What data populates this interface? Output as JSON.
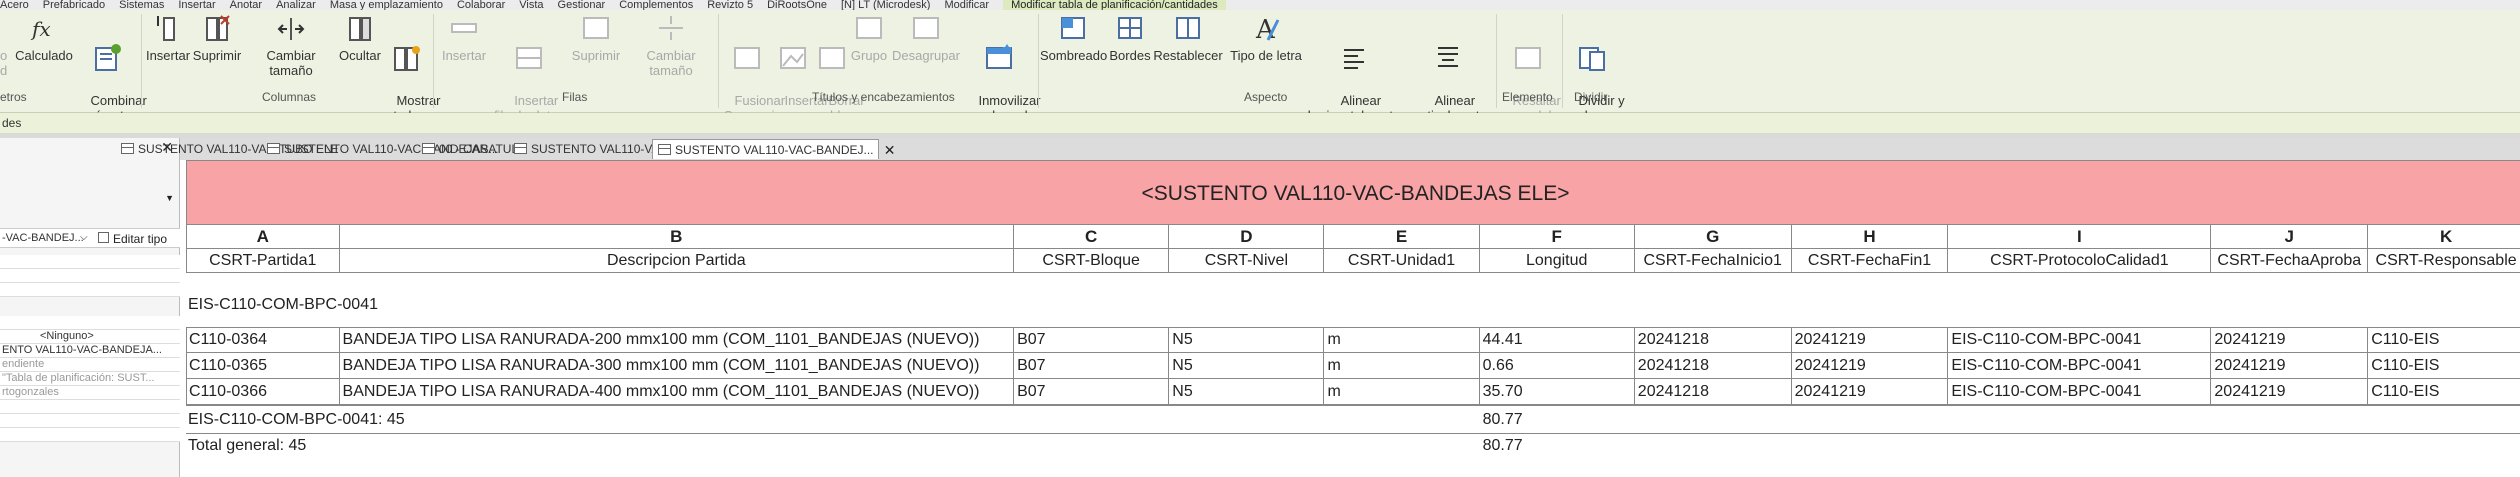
{
  "ribbon_tabs": [
    "Acero",
    "Prefabricado",
    "Sistemas",
    "Insertar",
    "Anotar",
    "Analizar",
    "Masa y emplazamiento",
    "Colaborar",
    "Vista",
    "Gestionar",
    "Complementos",
    "Revizto 5",
    "DiRootsOne",
    "[N] LT (Microdesk)",
    "Modificar",
    "Modificar tabla de planificación/cantidades"
  ],
  "ribbon_tools": {
    "parametros_partial": "o\nd",
    "calculado": "Calculado",
    "combinar": "Combinar\nparámetros",
    "insertar": "Insertar",
    "suprimir": "Suprimir",
    "cambiar_tamano": "Cambiar tamaño",
    "ocultar": "Ocultar",
    "mostrar_todo": "Mostrar\ntodo",
    "filas_insertar": "Insertar",
    "insertar_fila": "Insertar\nfila de datos",
    "filas_suprimir": "Suprimir",
    "filas_cambiar": "Cambiar tamaño",
    "fusionar": "Fusionar\nSeparar",
    "insertar_imagen": "Insertar\nimagen",
    "borrar_celda": "Borrar\ncelda",
    "grupo": "Grupo",
    "desagrupar": "Desagrupar",
    "inmovilizar": "Inmovilizar\nencabezado",
    "sombreado": "Sombreado",
    "bordes": "Bordes",
    "restablecer": "Restablecer",
    "tipo_letra": "Tipo de letra",
    "alinear_h": "Alinear\nhorizontalmente",
    "alinear_v": "Alinear\nverticalmente",
    "resaltar": "Resaltar\nen modelo",
    "dividir": "Dividir y\ncolocar"
  },
  "ribbon_groups": {
    "parametros": "etros",
    "columnas": "Columnas",
    "filas": "Filas",
    "titulos": "Títulos y encabezamientos",
    "aspecto": "Aspecto",
    "elemento": "Elemento",
    "dividir": "Dividir"
  },
  "strip_text": "des",
  "properties": {
    "type_name": "-VAC-BANDEJ...",
    "edit_type": "Editar tipo",
    "ninguno": "<Ninguno>",
    "view_name": "ENTO VAL110-VAC-BANDEJA...",
    "dependiente": "endiente",
    "tabla": "\"Tabla de planificación: SUST...",
    "ortogonales": "rtogonzales"
  },
  "view_tabs": [
    "SUSTENTO VAL110-VAC-TUBO ELE",
    "SUSTENTO VAL110-VAC-BANDEJAS...",
    "00 - CARATULA",
    "SUSTENTO VAL110-VAC-BANDEJAS...",
    "SUSTENTO VAL110-VAC-BANDEJ..."
  ],
  "schedule": {
    "title": "<SUSTENTO VAL110-VAC-BANDEJAS ELE>",
    "letters": [
      "A",
      "B",
      "C",
      "D",
      "E",
      "F",
      "G",
      "H",
      "I",
      "J",
      "K"
    ],
    "headers": [
      "CSRT-Partida1",
      "Descripcion Partida",
      "CSRT-Bloque",
      "CSRT-Nivel",
      "CSRT-Unidad1",
      "Longitud",
      "CSRT-FechaInicio1",
      "CSRT-FechaFin1",
      "CSRT-ProtocoloCalidad1",
      "CSRT-FechaAproba",
      "CSRT-Responsable"
    ],
    "group_header": "EIS-C110-COM-BPC-0041",
    "rows": [
      [
        "C110-0364",
        "BANDEJA TIPO LISA RANURADA-200 mmx100 mm (COM_1101_BANDEJAS (NUEVO))",
        "B07",
        "N5",
        "m",
        "44.41",
        "20241218",
        "20241219",
        "EIS-C110-COM-BPC-0041",
        "20241219",
        "C110-EIS"
      ],
      [
        "C110-0365",
        "BANDEJA TIPO LISA RANURADA-300 mmx100 mm (COM_1101_BANDEJAS (NUEVO))",
        "B07",
        "N5",
        "m",
        "0.66",
        "20241218",
        "20241219",
        "EIS-C110-COM-BPC-0041",
        "20241219",
        "C110-EIS"
      ],
      [
        "C110-0366",
        "BANDEJA TIPO LISA RANURADA-400 mmx100 mm (COM_1101_BANDEJAS (NUEVO))",
        "B07",
        "N5",
        "m",
        "35.70",
        "20241218",
        "20241219",
        "EIS-C110-COM-BPC-0041",
        "20241219",
        "C110-EIS"
      ]
    ],
    "group_footer_label": "EIS-C110-COM-BPC-0041: 45",
    "group_footer_total": "80.77",
    "grand_total_label": "Total general: 45",
    "grand_total_value": "80.77"
  }
}
